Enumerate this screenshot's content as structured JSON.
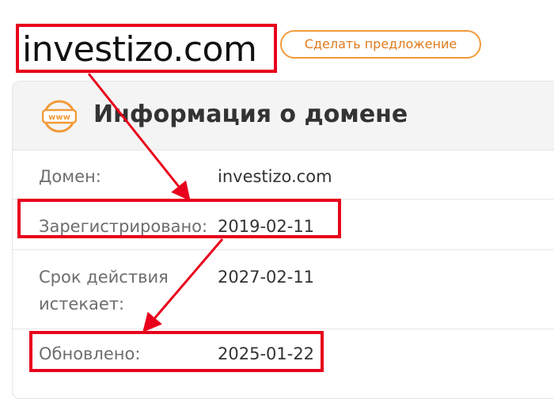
{
  "header": {
    "domain_name": "investizo.com",
    "offer_button_label": "Сделать предложение"
  },
  "card": {
    "title": "Информация о домене",
    "icon": "www-icon",
    "rows": [
      {
        "label": "Домен:",
        "value": "investizo.com"
      },
      {
        "label": "Зарегистрировано:",
        "value": "2019-02-11"
      },
      {
        "label": "Срок действия истекает:",
        "value": "2027-02-11"
      },
      {
        "label": "Обновлено:",
        "value": "2025-01-22"
      }
    ]
  },
  "colors": {
    "accent": "#f29a3a",
    "annotation": "#e8001c"
  }
}
